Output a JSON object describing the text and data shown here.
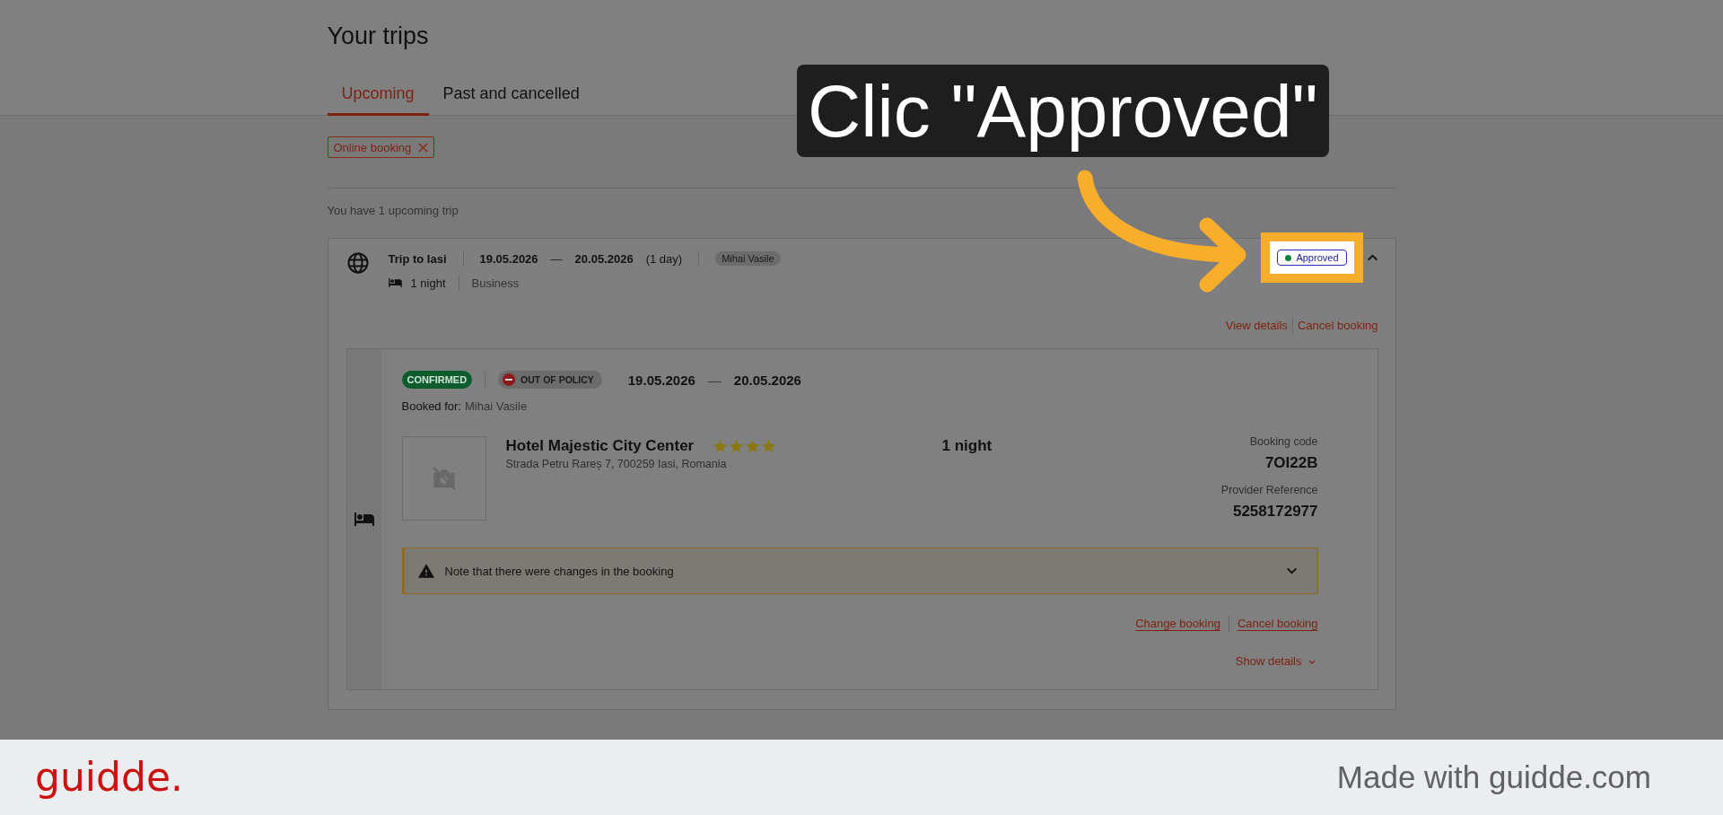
{
  "page": {
    "title": "Your trips"
  },
  "tabs": [
    {
      "label": "Upcoming",
      "selected": true
    },
    {
      "label": "Past and cancelled",
      "selected": false
    }
  ],
  "filters": [
    {
      "label": "Online booking"
    }
  ],
  "summary": "You have 1 upcoming trip",
  "trip": {
    "title": "Trip to Iasi",
    "start_date": "19.05.2026",
    "date_separator": "—",
    "end_date": "20.05.2026",
    "duration": "(1 day)",
    "traveler": "Mihai Vasile",
    "nights": "1 night",
    "purpose": "Business",
    "status": "Approved",
    "expanded": true,
    "actions": [
      {
        "label": "View details"
      },
      {
        "label": "Cancel booking"
      }
    ],
    "bookings": [
      {
        "kind": "hotel",
        "status": "CONFIRMED",
        "policy": "OUT OF POLICY",
        "start_date": "19.05.2026",
        "date_separator": "—",
        "end_date": "20.05.2026",
        "booked_for_label": "Booked for:",
        "booked_for": "Mihai Vasile",
        "hotel_name": "Hotel Majestic City Center",
        "stars": 4,
        "address": "Strada Petru Rareș 7, 700259 Iasi, Romania",
        "nights": "1 night",
        "booking_code_label": "Booking code",
        "booking_code": "7OI22B",
        "provider_reference_label": "Provider Reference",
        "provider_reference": "5258172977",
        "notice": {
          "text": "Note that there were changes in the booking",
          "expanded": false
        },
        "actions": [
          {
            "label": "Change booking"
          },
          {
            "label": "Cancel booking"
          }
        ],
        "details_toggle": "Show details"
      }
    ]
  },
  "callout": {
    "text": "Clic \"Approved\""
  },
  "footer": {
    "logo": "guidde.",
    "credit": "Made with guidde.com"
  }
}
